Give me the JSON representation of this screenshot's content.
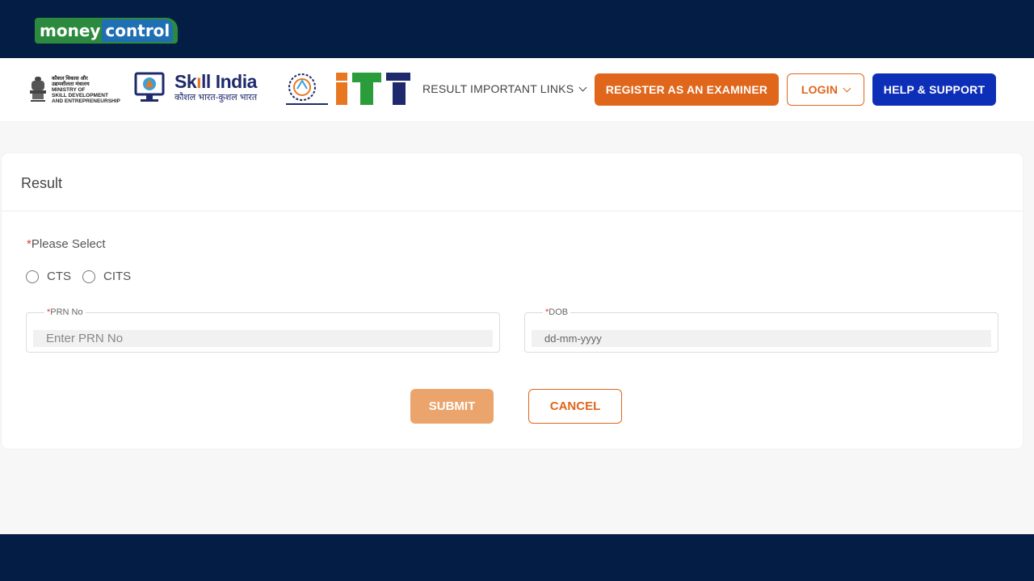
{
  "brand": {
    "part1": "money",
    "part2": "control"
  },
  "header": {
    "msde_lines": [
      "कौशल विकास और",
      "उद्यमशीलता मंत्रालय",
      "MINISTRY OF",
      "SKILL DEVELOPMENT",
      "AND ENTREPRENEURSHIP"
    ],
    "skill_india": {
      "title_a": "Sk",
      "title_b": "ll India",
      "subtitle": "कौशल भारत-कुशल भारत"
    },
    "nav": {
      "result": "RESULT",
      "important_links": "IMPORTANT LINKS"
    },
    "buttons": {
      "register": "REGISTER AS AN EXAMINER",
      "login": "LOGIN",
      "help": "HELP & SUPPORT"
    }
  },
  "card": {
    "title": "Result",
    "please_select": "Please Select",
    "options": [
      "CTS",
      "CITS"
    ],
    "prn": {
      "label": "PRN No",
      "placeholder": "Enter PRN No"
    },
    "dob": {
      "label": "DOB",
      "placeholder": "dd-mm-yyyy"
    },
    "submit": "SUBMIT",
    "cancel": "CANCEL"
  },
  "colors": {
    "navy": "#031d44",
    "orange": "#e0661b",
    "blue": "#0d2fb8"
  }
}
